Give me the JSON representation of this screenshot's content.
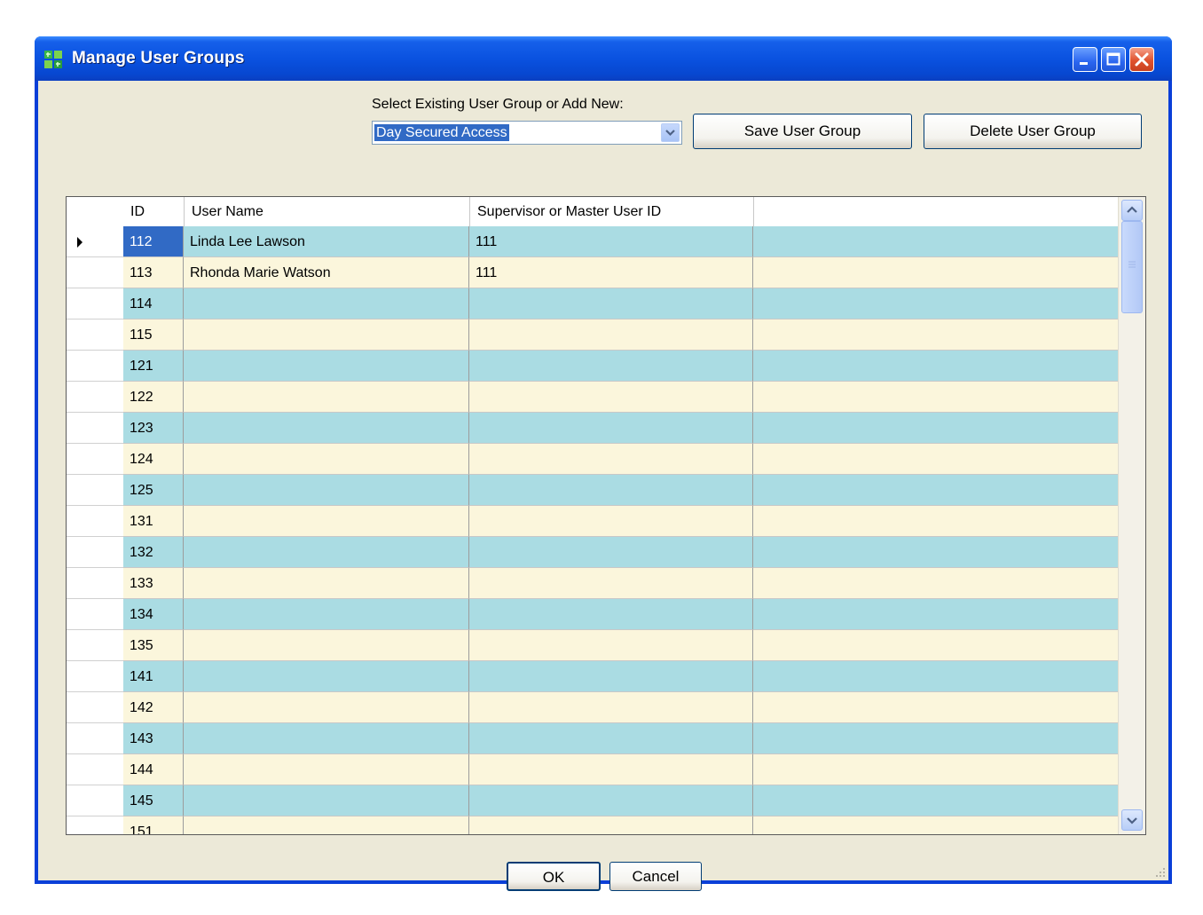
{
  "window": {
    "title": "Manage User Groups",
    "icon": "app-grid-icon"
  },
  "controls": {
    "select_label": "Select Existing User Group or Add New:",
    "selected_group": "Day Secured Access",
    "save_label": "Save User Group",
    "delete_label": "Delete User Group"
  },
  "grid": {
    "columns": [
      "ID",
      "User Name",
      "Supervisor or Master User ID"
    ],
    "rows": [
      {
        "id": "112",
        "name": "Linda Lee Lawson",
        "supervisor": "111"
      },
      {
        "id": "113",
        "name": "Rhonda Marie Watson",
        "supervisor": "111"
      },
      {
        "id": "114",
        "name": "",
        "supervisor": ""
      },
      {
        "id": "115",
        "name": "",
        "supervisor": ""
      },
      {
        "id": "121",
        "name": "",
        "supervisor": ""
      },
      {
        "id": "122",
        "name": "",
        "supervisor": ""
      },
      {
        "id": "123",
        "name": "",
        "supervisor": ""
      },
      {
        "id": "124",
        "name": "",
        "supervisor": ""
      },
      {
        "id": "125",
        "name": "",
        "supervisor": ""
      },
      {
        "id": "131",
        "name": "",
        "supervisor": ""
      },
      {
        "id": "132",
        "name": "",
        "supervisor": ""
      },
      {
        "id": "133",
        "name": "",
        "supervisor": ""
      },
      {
        "id": "134",
        "name": "",
        "supervisor": ""
      },
      {
        "id": "135",
        "name": "",
        "supervisor": ""
      },
      {
        "id": "141",
        "name": "",
        "supervisor": ""
      },
      {
        "id": "142",
        "name": "",
        "supervisor": ""
      },
      {
        "id": "143",
        "name": "",
        "supervisor": ""
      },
      {
        "id": "144",
        "name": "",
        "supervisor": ""
      },
      {
        "id": "145",
        "name": "",
        "supervisor": ""
      },
      {
        "id": "151",
        "name": "",
        "supervisor": ""
      }
    ]
  },
  "footer": {
    "ok_label": "OK",
    "cancel_label": "Cancel"
  },
  "colors": {
    "row_blue": "#aadce3",
    "row_cream": "#fbf6dc",
    "selection": "#316ac5",
    "titlebar": "#0a52e0"
  }
}
